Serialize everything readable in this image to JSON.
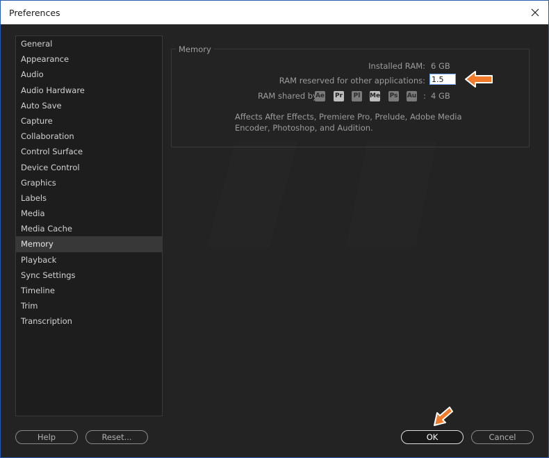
{
  "window": {
    "title": "Preferences",
    "close_label": "✕"
  },
  "sidebar": {
    "items": [
      {
        "label": "General"
      },
      {
        "label": "Appearance"
      },
      {
        "label": "Audio"
      },
      {
        "label": "Audio Hardware"
      },
      {
        "label": "Auto Save"
      },
      {
        "label": "Capture"
      },
      {
        "label": "Collaboration"
      },
      {
        "label": "Control Surface"
      },
      {
        "label": "Device Control"
      },
      {
        "label": "Graphics"
      },
      {
        "label": "Labels"
      },
      {
        "label": "Media"
      },
      {
        "label": "Media Cache"
      },
      {
        "label": "Memory"
      },
      {
        "label": "Playback"
      },
      {
        "label": "Sync Settings"
      },
      {
        "label": "Timeline"
      },
      {
        "label": "Trim"
      },
      {
        "label": "Transcription"
      }
    ],
    "selected": "Memory"
  },
  "memory": {
    "section_title": "Memory",
    "installed_ram_label": "Installed RAM:",
    "installed_ram_value": "6 GB",
    "reserved_label": "RAM reserved for other applications:",
    "reserved_value": "1.5",
    "shared_label": "RAM shared by",
    "shared_apps": [
      "Ae",
      "Pr",
      "Pl",
      "Me",
      "Ps",
      "Au"
    ],
    "shared_sep": ":",
    "shared_value": "4 GB",
    "note": "Affects After Effects, Premiere Pro, Prelude, Adobe Media Encoder, Photoshop, and Audition."
  },
  "footer": {
    "help_label": "Help",
    "reset_label": "Reset...",
    "ok_label": "OK",
    "cancel_label": "Cancel"
  },
  "colors": {
    "accent_arrow": "#f07a2a",
    "window_bg": "#232323",
    "focus_border": "#6fa8ff"
  }
}
